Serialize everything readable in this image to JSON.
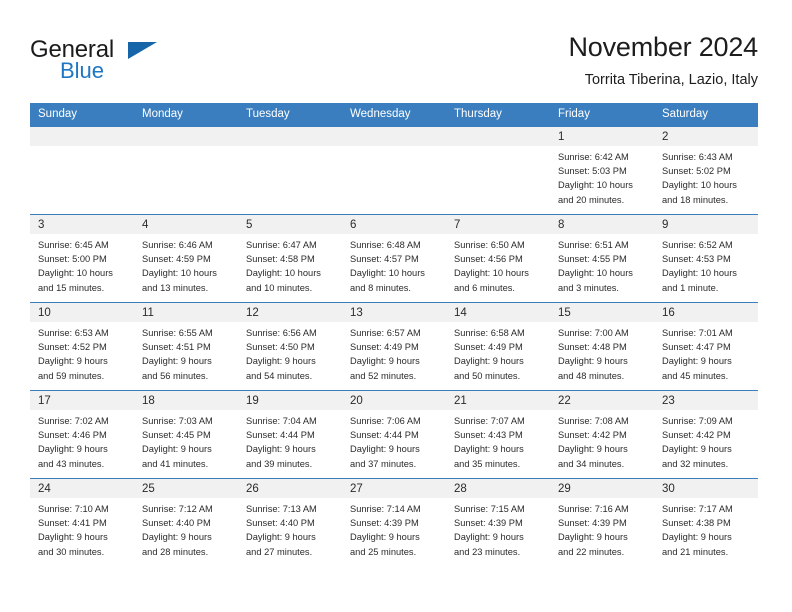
{
  "brand": {
    "name_part1": "General",
    "name_part2": "Blue",
    "triangle_color": "#1565a8",
    "blue_color": "#1f77c4"
  },
  "header": {
    "title": "November 2024",
    "subtitle": "Torrita Tiberina, Lazio, Italy"
  },
  "theme": {
    "header_bg": "#3a7ebf",
    "daynum_bg": "#f1f1f1",
    "text": "#2b2b2b"
  },
  "weekday_headers": [
    "Sunday",
    "Monday",
    "Tuesday",
    "Wednesday",
    "Thursday",
    "Friday",
    "Saturday"
  ],
  "weeks": [
    [
      {
        "day": "",
        "blank": true,
        "sunrise": "",
        "sunset": "",
        "daylight_line1": "",
        "daylight_line2": ""
      },
      {
        "day": "",
        "blank": true,
        "sunrise": "",
        "sunset": "",
        "daylight_line1": "",
        "daylight_line2": ""
      },
      {
        "day": "",
        "blank": true,
        "sunrise": "",
        "sunset": "",
        "daylight_line1": "",
        "daylight_line2": ""
      },
      {
        "day": "",
        "blank": true,
        "sunrise": "",
        "sunset": "",
        "daylight_line1": "",
        "daylight_line2": ""
      },
      {
        "day": "",
        "blank": true,
        "sunrise": "",
        "sunset": "",
        "daylight_line1": "",
        "daylight_line2": ""
      },
      {
        "day": "1",
        "blank": false,
        "sunrise": "Sunrise: 6:42 AM",
        "sunset": "Sunset: 5:03 PM",
        "daylight_line1": "Daylight: 10 hours",
        "daylight_line2": "and 20 minutes."
      },
      {
        "day": "2",
        "blank": false,
        "sunrise": "Sunrise: 6:43 AM",
        "sunset": "Sunset: 5:02 PM",
        "daylight_line1": "Daylight: 10 hours",
        "daylight_line2": "and 18 minutes."
      }
    ],
    [
      {
        "day": "3",
        "blank": false,
        "sunrise": "Sunrise: 6:45 AM",
        "sunset": "Sunset: 5:00 PM",
        "daylight_line1": "Daylight: 10 hours",
        "daylight_line2": "and 15 minutes."
      },
      {
        "day": "4",
        "blank": false,
        "sunrise": "Sunrise: 6:46 AM",
        "sunset": "Sunset: 4:59 PM",
        "daylight_line1": "Daylight: 10 hours",
        "daylight_line2": "and 13 minutes."
      },
      {
        "day": "5",
        "blank": false,
        "sunrise": "Sunrise: 6:47 AM",
        "sunset": "Sunset: 4:58 PM",
        "daylight_line1": "Daylight: 10 hours",
        "daylight_line2": "and 10 minutes."
      },
      {
        "day": "6",
        "blank": false,
        "sunrise": "Sunrise: 6:48 AM",
        "sunset": "Sunset: 4:57 PM",
        "daylight_line1": "Daylight: 10 hours",
        "daylight_line2": "and 8 minutes."
      },
      {
        "day": "7",
        "blank": false,
        "sunrise": "Sunrise: 6:50 AM",
        "sunset": "Sunset: 4:56 PM",
        "daylight_line1": "Daylight: 10 hours",
        "daylight_line2": "and 6 minutes."
      },
      {
        "day": "8",
        "blank": false,
        "sunrise": "Sunrise: 6:51 AM",
        "sunset": "Sunset: 4:55 PM",
        "daylight_line1": "Daylight: 10 hours",
        "daylight_line2": "and 3 minutes."
      },
      {
        "day": "9",
        "blank": false,
        "sunrise": "Sunrise: 6:52 AM",
        "sunset": "Sunset: 4:53 PM",
        "daylight_line1": "Daylight: 10 hours",
        "daylight_line2": "and 1 minute."
      }
    ],
    [
      {
        "day": "10",
        "blank": false,
        "sunrise": "Sunrise: 6:53 AM",
        "sunset": "Sunset: 4:52 PM",
        "daylight_line1": "Daylight: 9 hours",
        "daylight_line2": "and 59 minutes."
      },
      {
        "day": "11",
        "blank": false,
        "sunrise": "Sunrise: 6:55 AM",
        "sunset": "Sunset: 4:51 PM",
        "daylight_line1": "Daylight: 9 hours",
        "daylight_line2": "and 56 minutes."
      },
      {
        "day": "12",
        "blank": false,
        "sunrise": "Sunrise: 6:56 AM",
        "sunset": "Sunset: 4:50 PM",
        "daylight_line1": "Daylight: 9 hours",
        "daylight_line2": "and 54 minutes."
      },
      {
        "day": "13",
        "blank": false,
        "sunrise": "Sunrise: 6:57 AM",
        "sunset": "Sunset: 4:49 PM",
        "daylight_line1": "Daylight: 9 hours",
        "daylight_line2": "and 52 minutes."
      },
      {
        "day": "14",
        "blank": false,
        "sunrise": "Sunrise: 6:58 AM",
        "sunset": "Sunset: 4:49 PM",
        "daylight_line1": "Daylight: 9 hours",
        "daylight_line2": "and 50 minutes."
      },
      {
        "day": "15",
        "blank": false,
        "sunrise": "Sunrise: 7:00 AM",
        "sunset": "Sunset: 4:48 PM",
        "daylight_line1": "Daylight: 9 hours",
        "daylight_line2": "and 48 minutes."
      },
      {
        "day": "16",
        "blank": false,
        "sunrise": "Sunrise: 7:01 AM",
        "sunset": "Sunset: 4:47 PM",
        "daylight_line1": "Daylight: 9 hours",
        "daylight_line2": "and 45 minutes."
      }
    ],
    [
      {
        "day": "17",
        "blank": false,
        "sunrise": "Sunrise: 7:02 AM",
        "sunset": "Sunset: 4:46 PM",
        "daylight_line1": "Daylight: 9 hours",
        "daylight_line2": "and 43 minutes."
      },
      {
        "day": "18",
        "blank": false,
        "sunrise": "Sunrise: 7:03 AM",
        "sunset": "Sunset: 4:45 PM",
        "daylight_line1": "Daylight: 9 hours",
        "daylight_line2": "and 41 minutes."
      },
      {
        "day": "19",
        "blank": false,
        "sunrise": "Sunrise: 7:04 AM",
        "sunset": "Sunset: 4:44 PM",
        "daylight_line1": "Daylight: 9 hours",
        "daylight_line2": "and 39 minutes."
      },
      {
        "day": "20",
        "blank": false,
        "sunrise": "Sunrise: 7:06 AM",
        "sunset": "Sunset: 4:44 PM",
        "daylight_line1": "Daylight: 9 hours",
        "daylight_line2": "and 37 minutes."
      },
      {
        "day": "21",
        "blank": false,
        "sunrise": "Sunrise: 7:07 AM",
        "sunset": "Sunset: 4:43 PM",
        "daylight_line1": "Daylight: 9 hours",
        "daylight_line2": "and 35 minutes."
      },
      {
        "day": "22",
        "blank": false,
        "sunrise": "Sunrise: 7:08 AM",
        "sunset": "Sunset: 4:42 PM",
        "daylight_line1": "Daylight: 9 hours",
        "daylight_line2": "and 34 minutes."
      },
      {
        "day": "23",
        "blank": false,
        "sunrise": "Sunrise: 7:09 AM",
        "sunset": "Sunset: 4:42 PM",
        "daylight_line1": "Daylight: 9 hours",
        "daylight_line2": "and 32 minutes."
      }
    ],
    [
      {
        "day": "24",
        "blank": false,
        "sunrise": "Sunrise: 7:10 AM",
        "sunset": "Sunset: 4:41 PM",
        "daylight_line1": "Daylight: 9 hours",
        "daylight_line2": "and 30 minutes."
      },
      {
        "day": "25",
        "blank": false,
        "sunrise": "Sunrise: 7:12 AM",
        "sunset": "Sunset: 4:40 PM",
        "daylight_line1": "Daylight: 9 hours",
        "daylight_line2": "and 28 minutes."
      },
      {
        "day": "26",
        "blank": false,
        "sunrise": "Sunrise: 7:13 AM",
        "sunset": "Sunset: 4:40 PM",
        "daylight_line1": "Daylight: 9 hours",
        "daylight_line2": "and 27 minutes."
      },
      {
        "day": "27",
        "blank": false,
        "sunrise": "Sunrise: 7:14 AM",
        "sunset": "Sunset: 4:39 PM",
        "daylight_line1": "Daylight: 9 hours",
        "daylight_line2": "and 25 minutes."
      },
      {
        "day": "28",
        "blank": false,
        "sunrise": "Sunrise: 7:15 AM",
        "sunset": "Sunset: 4:39 PM",
        "daylight_line1": "Daylight: 9 hours",
        "daylight_line2": "and 23 minutes."
      },
      {
        "day": "29",
        "blank": false,
        "sunrise": "Sunrise: 7:16 AM",
        "sunset": "Sunset: 4:39 PM",
        "daylight_line1": "Daylight: 9 hours",
        "daylight_line2": "and 22 minutes."
      },
      {
        "day": "30",
        "blank": false,
        "sunrise": "Sunrise: 7:17 AM",
        "sunset": "Sunset: 4:38 PM",
        "daylight_line1": "Daylight: 9 hours",
        "daylight_line2": "and 21 minutes."
      }
    ]
  ]
}
